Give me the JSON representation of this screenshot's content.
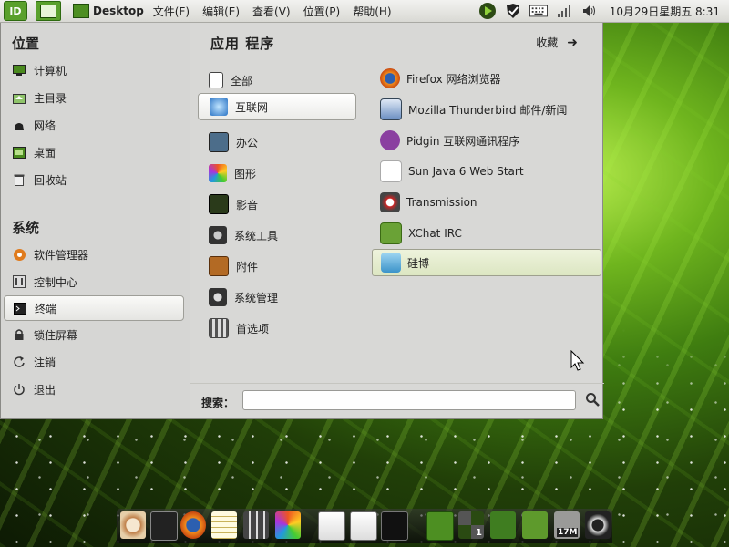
{
  "top_panel": {
    "logo_text": "lD",
    "app_title": "Desktop",
    "menus": [
      "文件(F)",
      "编辑(E)",
      "查看(V)",
      "位置(P)",
      "帮助(H)"
    ],
    "clock": "10月29日星期五  8:31",
    "tray_icons": [
      "play-icon",
      "checkmark-icon",
      "keyboard-icon",
      "signal-icon",
      "volume-icon"
    ]
  },
  "places": {
    "header": "位置",
    "items": [
      "计算机",
      "主目录",
      "网络",
      "桌面",
      "回收站"
    ]
  },
  "system": {
    "header": "系统",
    "items": [
      "软件管理器",
      "控制中心",
      "终端",
      "锁住屏幕",
      "注销",
      "退出"
    ]
  },
  "applications": {
    "header": "应用 程序",
    "favorites_label": "收藏",
    "categories": [
      "全部",
      "互联网",
      "办公",
      "图形",
      "影音",
      "系统工具",
      "附件",
      "系统管理",
      "首选项"
    ],
    "selected_category": "互联网",
    "apps": [
      "Firefox 网络浏览器",
      "Mozilla Thunderbird 邮件/新闻",
      "Pidgin 互联网通讯程序",
      "Sun Java 6 Web Start",
      "Transmission",
      "XChat IRC",
      "硅博"
    ],
    "selected_app": "硅博"
  },
  "search": {
    "label": "搜索：",
    "value": "",
    "placeholder": ""
  },
  "dock": {
    "badges": [
      "1",
      "17M"
    ]
  },
  "colors": {
    "accent_green": "#5aa02c",
    "menu_bg": "#d8d8d6"
  }
}
